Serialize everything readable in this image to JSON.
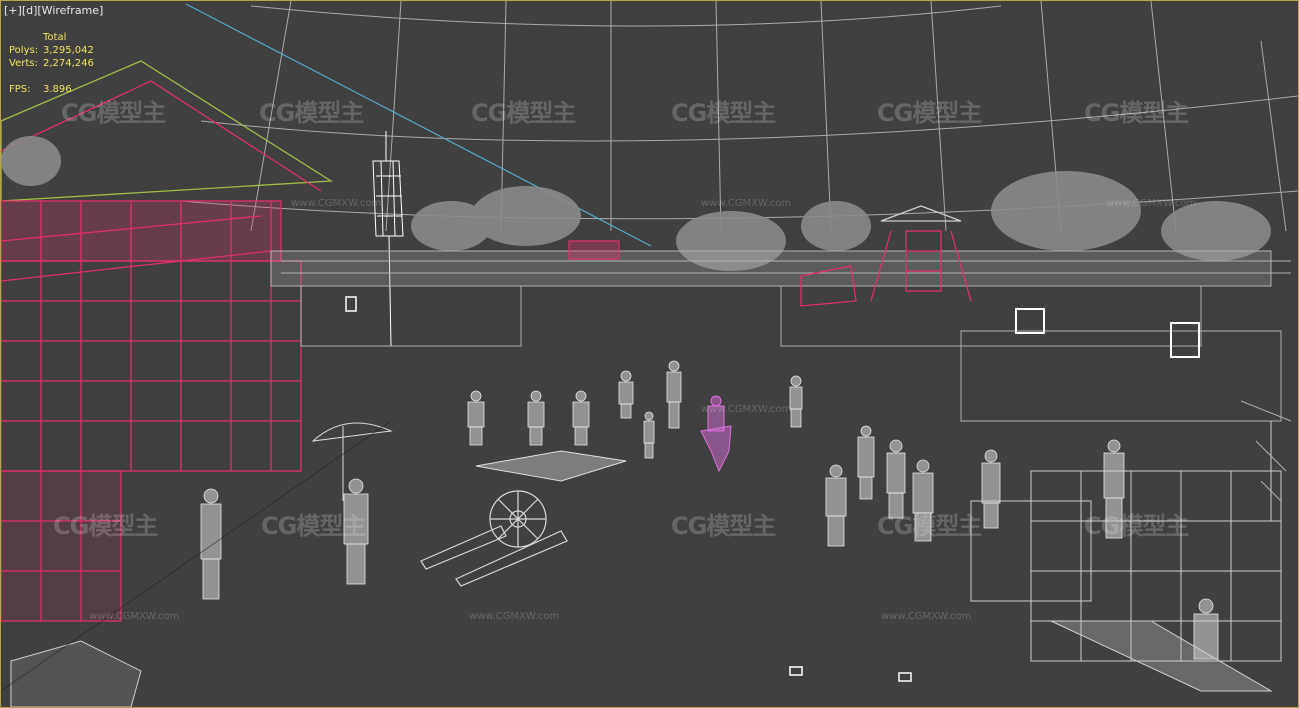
{
  "viewport": {
    "label_plus": "[+]",
    "label_view": "[d]",
    "label_shading": "[Wireframe]"
  },
  "stats": {
    "total_label": "Total",
    "polys_label": "Polys:",
    "polys_value": "3,295,042",
    "verts_label": "Verts:",
    "verts_value": "2,274,246",
    "fps_label": "FPS:",
    "fps_value": "3.896"
  },
  "watermark": {
    "logo_text": "CG模型主",
    "url_text": "www.CGMXW.com"
  },
  "colors": {
    "background": "#404040",
    "wire_white": "#d8d8d8",
    "wire_magenta": "#e0306a",
    "wire_pink": "#e070e0",
    "wire_gray": "#a8a8a8",
    "stats_yellow": "#f2e45c",
    "frame_border": "#b8a24a"
  }
}
